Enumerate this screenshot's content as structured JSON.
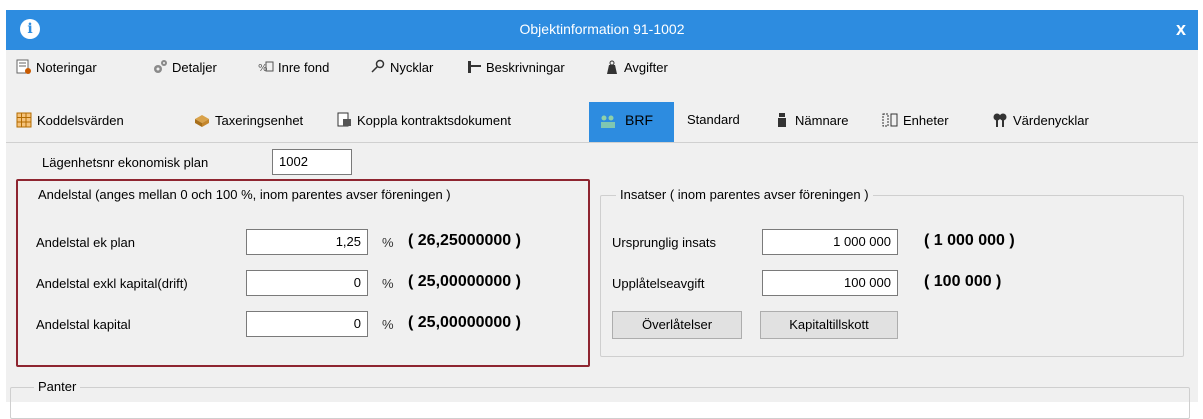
{
  "window": {
    "title": "Objektinformation 91-1002",
    "close_label": "x",
    "info_label": "i"
  },
  "toolbar1": [
    {
      "label": "Noteringar",
      "icon": "notes-icon"
    },
    {
      "label": "Detaljer",
      "icon": "gears-icon"
    },
    {
      "label": "Inre fond",
      "icon": "fund-icon"
    },
    {
      "label": "Nycklar",
      "icon": "key-icon"
    },
    {
      "label": "Beskrivningar",
      "icon": "description-icon"
    },
    {
      "label": "Avgifter",
      "icon": "weight-icon"
    }
  ],
  "toolbar2": [
    {
      "label": "Koddelsvärden",
      "icon": "code-values-icon"
    },
    {
      "label": "Taxeringsenhet",
      "icon": "tax-unit-icon"
    },
    {
      "label": "Koppla kontraktsdokument",
      "icon": "link-document-icon"
    },
    {
      "label": "BRF",
      "icon": "brf-icon",
      "active": true
    },
    {
      "label": "Standard",
      "icon": ""
    },
    {
      "label": "Nämnare",
      "icon": "denominator-icon"
    },
    {
      "label": "Enheter",
      "icon": "units-icon"
    },
    {
      "label": "Värdenycklar",
      "icon": "value-keys-icon"
    }
  ],
  "form": {
    "apartment_label": "Lägenhetsnr ekonomisk plan",
    "apartment_value": "1002",
    "andelstal": {
      "legend": "Andelstal (anges mellan 0 och 100 %, inom parentes avser föreningen )",
      "rows": [
        {
          "label": "Andelstal ek plan",
          "value": "1,25",
          "unit": "%",
          "assoc": "( 26,25000000 )"
        },
        {
          "label": "Andelstal exkl kapital(drift)",
          "value": "0",
          "unit": "%",
          "assoc": "( 25,00000000 )"
        },
        {
          "label": "Andelstal kapital",
          "value": "0",
          "unit": "%",
          "assoc": "( 25,00000000 )"
        }
      ]
    },
    "insatser": {
      "legend": "Insatser ( inom parentes avser föreningen )",
      "rows": [
        {
          "label": "Ursprunglig insats",
          "value": "1 000 000",
          "assoc": "( 1 000 000 )"
        },
        {
          "label": "Upplåtelseavgift",
          "value": "100 000",
          "assoc": "( 100 000 )"
        }
      ],
      "buttons": {
        "overlatelser": "Överlåtelser",
        "kapitaltillskott": "Kapitaltillskott"
      }
    },
    "panter_legend": "Panter"
  },
  "colors": {
    "accent": "#2d8ce0",
    "highlight_border": "#8e2530"
  }
}
